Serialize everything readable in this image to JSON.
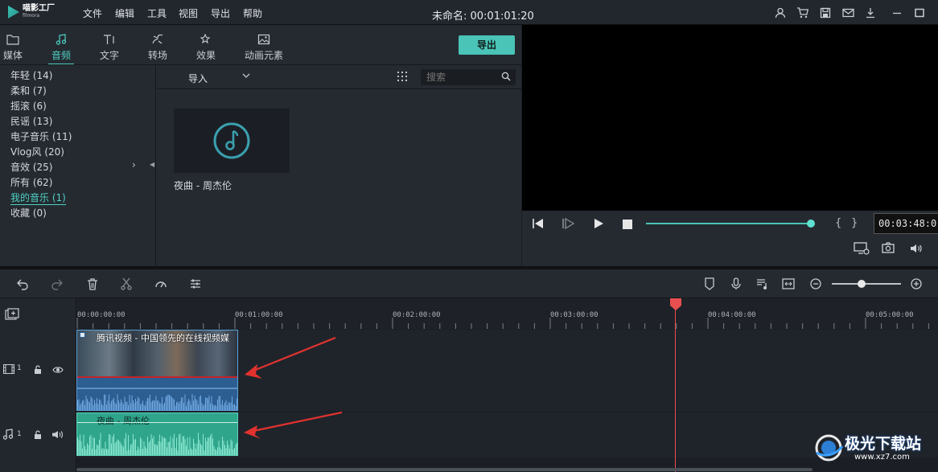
{
  "app": {
    "logo_text": "喵影工厂",
    "logo_sub": "filmora",
    "menus": [
      "文件",
      "编辑",
      "工具",
      "视图",
      "导出",
      "帮助"
    ],
    "doc_title": "未命名: 00:01:01:20"
  },
  "tabs": [
    {
      "label": "媒体",
      "icon": "folder-icon"
    },
    {
      "label": "音频",
      "icon": "music-note-icon",
      "active": true
    },
    {
      "label": "文字",
      "icon": "text-icon"
    },
    {
      "label": "转场",
      "icon": "transition-icon"
    },
    {
      "label": "效果",
      "icon": "effects-icon"
    },
    {
      "label": "动画元素",
      "icon": "image-icon"
    }
  ],
  "export_label": "导出",
  "categories": [
    "年轻 (14)",
    "柔和 (7)",
    "摇滚 (6)",
    "民谣 (13)",
    "电子音乐 (11)",
    "Vlog风 (20)",
    "音效 (25)",
    "所有 (62)",
    "我的音乐 (1)",
    "收藏 (0)"
  ],
  "active_category_index": 8,
  "import_label": "导入",
  "search_placeholder": "搜索",
  "media_items": [
    {
      "label": "夜曲 - 周杰伦"
    }
  ],
  "player": {
    "time": "00:03:48:0",
    "progress": 1.0
  },
  "ruler_labels": [
    "00:00:00:00",
    "00:01:00:00",
    "00:02:00:00",
    "00:03:00:00",
    "00:04:00:00",
    "00:05:00:00"
  ],
  "tracks": {
    "video": {
      "number": "1",
      "clip_label": "腾讯视频 - 中国领先的在线视频媒"
    },
    "audio": {
      "number": "1",
      "clip_label": "夜曲 - 周杰伦"
    }
  },
  "colors": {
    "accent": "#4fd1c2",
    "playhead": "#e84f4f",
    "video_clip": "#2d5e92",
    "audio_clip": "#2fa58c"
  },
  "watermark": {
    "text": "极光下载站",
    "url": "www.xz7.com"
  }
}
